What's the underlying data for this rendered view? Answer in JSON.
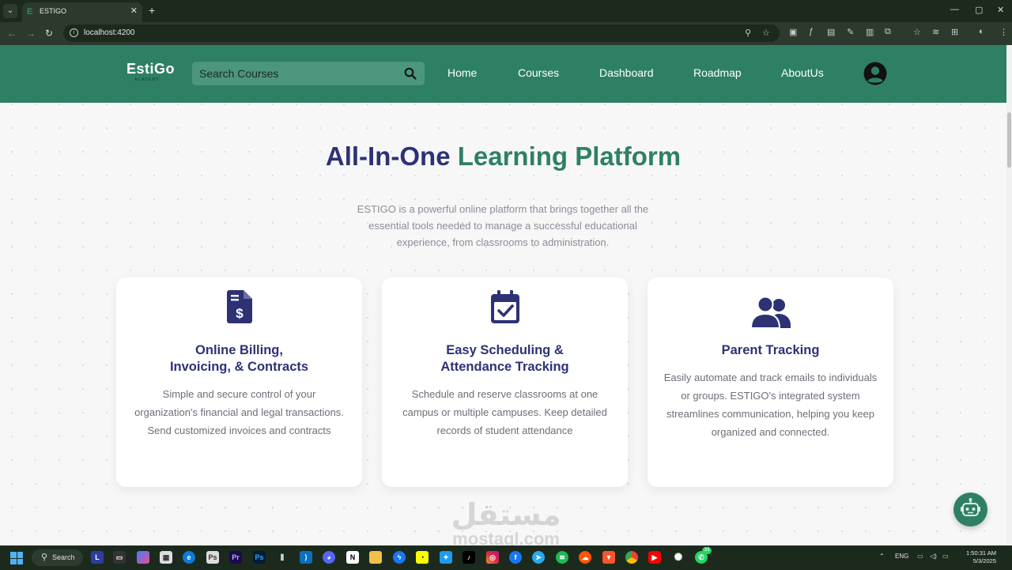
{
  "browser": {
    "tab_title": "ESTIGO",
    "url": "localhost:4200"
  },
  "navbar": {
    "logo_text": "EstiGo",
    "logo_sub": "ACADEMY",
    "search_placeholder": "Search Courses",
    "links": [
      "Home",
      "Courses",
      "Dashboard",
      "Roadmap",
      "AboutUs"
    ]
  },
  "hero": {
    "title_part1": "All-In-One",
    "title_part2": "Learning Platform",
    "description": "ESTIGO is a powerful online platform that brings together all the essential tools needed to manage a successful educational experience, from classrooms to administration."
  },
  "cards": [
    {
      "icon": "invoice-dollar-icon",
      "title_line1": "Online Billing,",
      "title_line2": "Invoicing, & Contracts",
      "text": "Simple and secure control of your organization's financial and legal transactions. Send customized invoices and contracts"
    },
    {
      "icon": "calendar-check-icon",
      "title_line1": "Easy Scheduling &",
      "title_line2": "Attendance Tracking",
      "text": "Schedule and reserve classrooms at one campus or multiple campuses. Keep detailed records of student attendance"
    },
    {
      "icon": "user-group-icon",
      "title_line1": "Parent Tracking",
      "title_line2": "",
      "text": "Easily automate and track emails to individuals or groups. ESTIGO's integrated system streamlines communication, helping you keep organized and connected."
    }
  ],
  "watermark": {
    "arabic": "مستقل",
    "latin": "mostaql.com"
  },
  "taskbar": {
    "search_label": "Search",
    "language": "ENG",
    "time": "1:50:31 AM",
    "date": "5/3/2025",
    "badge_count": "33"
  },
  "colors": {
    "brand_green": "#2e8065",
    "brand_navy": "#2d3275"
  }
}
